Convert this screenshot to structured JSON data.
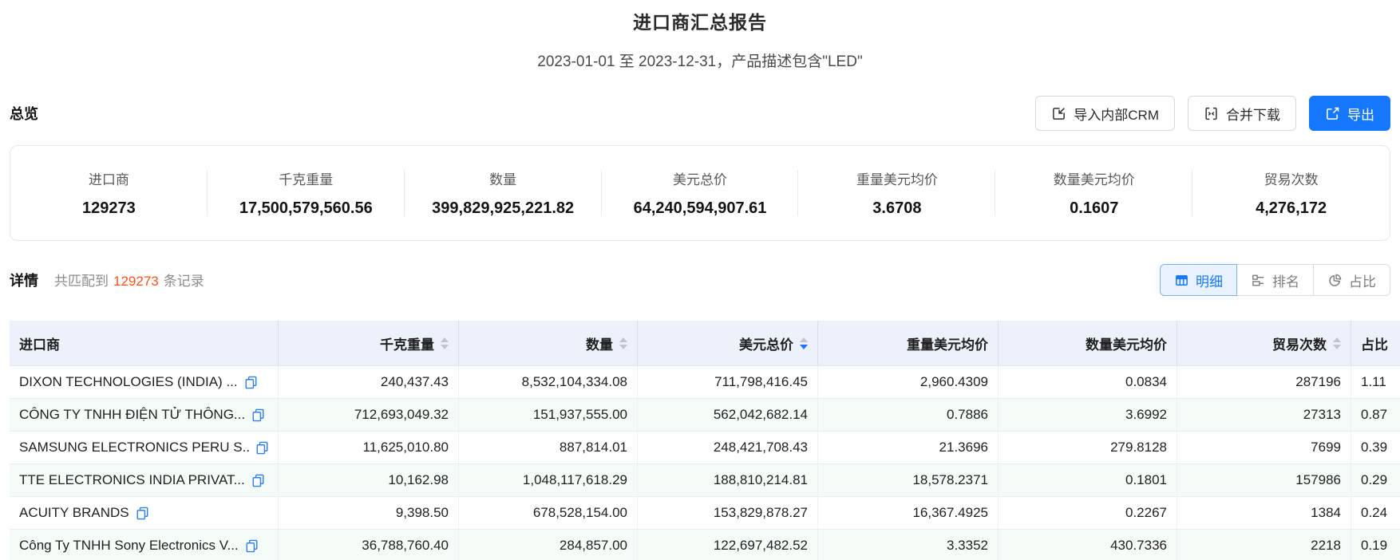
{
  "colors": {
    "accent": "#1677ff",
    "match_count": "#fa541c",
    "table_header_bg": "#edf1f9",
    "stripe_bg": "#f5fbf7"
  },
  "header": {
    "title": "进口商汇总报告",
    "subtitle": "2023-01-01 至 2023-12-31，产品描述包含\"LED\""
  },
  "overview": {
    "heading": "总览",
    "buttons": [
      {
        "label": "导入内部CRM",
        "icon": "import-icon"
      },
      {
        "label": "合并下载",
        "icon": "merge-download-icon"
      },
      {
        "label": "导出",
        "icon": "export-icon"
      }
    ],
    "stats": [
      {
        "label": "进口商",
        "value": "129273"
      },
      {
        "label": "千克重量",
        "value": "17,500,579,560.56"
      },
      {
        "label": "数量",
        "value": "399,829,925,221.82"
      },
      {
        "label": "美元总价",
        "value": "64,240,594,907.61"
      },
      {
        "label": "重量美元均价",
        "value": "3.6708"
      },
      {
        "label": "数量美元均价",
        "value": "0.1607"
      },
      {
        "label": "贸易次数",
        "value": "4,276,172"
      }
    ]
  },
  "details": {
    "heading": "详情",
    "match_prefix": "共匹配到",
    "match_count": "129273",
    "match_suffix": "条记录",
    "view_tabs": [
      {
        "label": "明细",
        "icon": "table-icon",
        "active": true
      },
      {
        "label": "排名",
        "icon": "ranking-icon",
        "active": false
      },
      {
        "label": "占比",
        "icon": "pie-icon",
        "active": false
      }
    ]
  },
  "table": {
    "columns": [
      {
        "label": "进口商",
        "sortable": false
      },
      {
        "label": "千克重量",
        "sortable": true
      },
      {
        "label": "数量",
        "sortable": true
      },
      {
        "label": "美元总价",
        "sortable": true,
        "sort": "desc"
      },
      {
        "label": "重量美元均价",
        "sortable": false
      },
      {
        "label": "数量美元均价",
        "sortable": false
      },
      {
        "label": "贸易次数",
        "sortable": true
      },
      {
        "label": "占比",
        "sortable": false
      }
    ],
    "rows": [
      {
        "importer": "DIXON TECHNOLOGIES (INDIA) ...",
        "values": [
          "240,437.43",
          "8,532,104,334.08",
          "711,798,416.45",
          "2,960.4309",
          "0.0834",
          "287196",
          "1.11"
        ]
      },
      {
        "importer": "CÔNG TY TNHH ĐIỆN TỬ THÔNG...",
        "values": [
          "712,693,049.32",
          "151,937,555.00",
          "562,042,682.14",
          "0.7886",
          "3.6992",
          "27313",
          "0.87"
        ]
      },
      {
        "importer": "SAMSUNG ELECTRONICS PERU S...",
        "values": [
          "11,625,010.80",
          "887,814.01",
          "248,421,708.43",
          "21.3696",
          "279.8128",
          "7699",
          "0.39"
        ]
      },
      {
        "importer": "TTE ELECTRONICS INDIA PRIVAT...",
        "values": [
          "10,162.98",
          "1,048,117,618.29",
          "188,810,214.81",
          "18,578.2371",
          "0.1801",
          "157986",
          "0.29"
        ]
      },
      {
        "importer": "ACUITY BRANDS",
        "values": [
          "9,398.50",
          "678,528,154.00",
          "153,829,878.27",
          "16,367.4925",
          "0.2267",
          "1384",
          "0.24"
        ]
      },
      {
        "importer": "Công Ty TNHH Sony Electronics V...",
        "values": [
          "36,788,760.40",
          "284,857.00",
          "122,697,482.52",
          "3.3352",
          "430.7336",
          "2218",
          "0.19"
        ]
      }
    ]
  }
}
